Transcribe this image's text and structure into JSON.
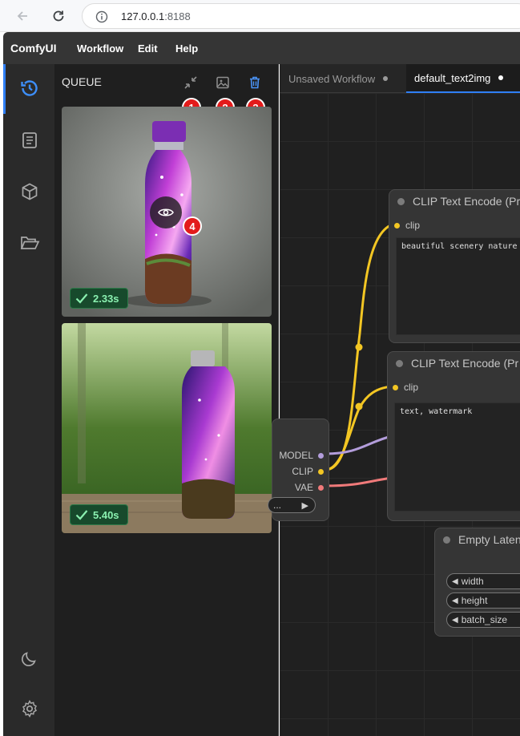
{
  "browser": {
    "url_host": "127.0.0.1",
    "url_port": ":8188"
  },
  "menubar": {
    "brand": "ComfyUI",
    "items": [
      "Workflow",
      "Edit",
      "Help"
    ]
  },
  "sidebar": {
    "items": [
      "queue-history",
      "model-library",
      "node-library",
      "workflows"
    ],
    "bottom_items": [
      "theme-toggle",
      "settings"
    ]
  },
  "queue": {
    "title": "QUEUE",
    "tools": [
      "collapse",
      "gallery",
      "clear"
    ],
    "markers": [
      "1",
      "2",
      "3",
      "4"
    ],
    "results": [
      {
        "time": "2.33s"
      },
      {
        "time": "5.40s"
      }
    ]
  },
  "tabs": [
    {
      "label": "Unsaved Workflow",
      "active": false
    },
    {
      "label": "default_text2img",
      "active": true
    }
  ],
  "nodes": {
    "clip_pos": {
      "title": "CLIP Text Encode (Pr",
      "input": "clip",
      "text": "beautiful scenery nature glass"
    },
    "clip_neg": {
      "title": "CLIP Text Encode (Pr",
      "input": "clip",
      "text": "text, watermark"
    },
    "checkpoint": {
      "outputs": [
        "MODEL",
        "CLIP",
        "VAE"
      ],
      "widget": "..."
    },
    "latent": {
      "title": "Empty Latent",
      "widgets": [
        "width",
        "height",
        "batch_size"
      ]
    }
  },
  "colors": {
    "accent": "#2f7ff6",
    "success": "#8af0b0",
    "marker": "#e31b1b",
    "clip_wire": "#f3c623",
    "model_wire": "#b39ddb",
    "vae_wire": "#f07a7a"
  }
}
